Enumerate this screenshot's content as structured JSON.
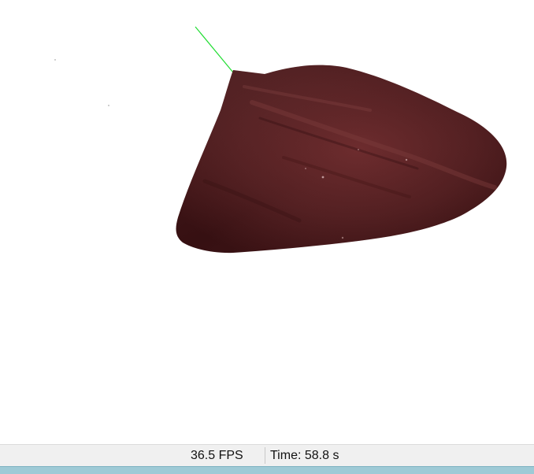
{
  "viewport": {
    "object": "organ-mesh",
    "axis_color": "#22dd33",
    "tissue_colors": {
      "dark": "#3e1213",
      "mid": "#5a2022",
      "light": "#7a3a3b"
    }
  },
  "status": {
    "fps": "36.5 FPS",
    "time": "Time: 58.8 s"
  },
  "colors": {
    "statusbar_bg": "#f0f0f0",
    "bottom_strip": "#9ecad6"
  }
}
